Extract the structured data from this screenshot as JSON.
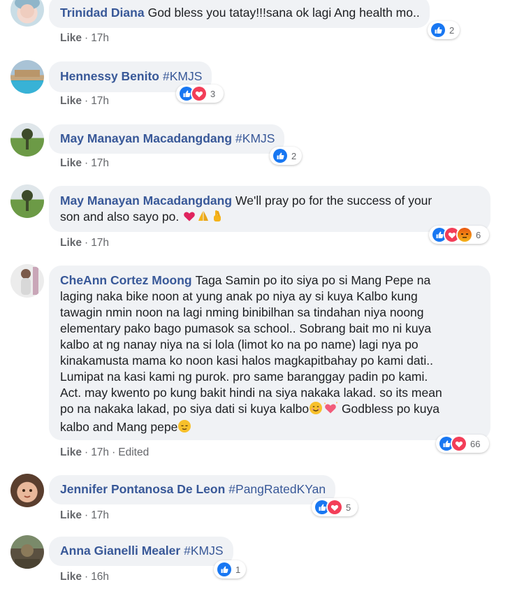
{
  "comments": [
    {
      "author": "Trinidad Diana",
      "text": "God bless you tatay!!!sana ok lagi Ang health mo..",
      "like_label": "Like",
      "time": "17h",
      "reactions": {
        "types": [
          "like"
        ],
        "count": "2"
      }
    },
    {
      "author": "Hennessy Benito",
      "tag": "#KMJS",
      "like_label": "Like",
      "time": "17h",
      "reactions": {
        "types": [
          "like",
          "love"
        ],
        "count": "3"
      }
    },
    {
      "author": "May Manayan Macadangdang",
      "tag": "#KMJS",
      "like_label": "Like",
      "time": "17h",
      "reactions": {
        "types": [
          "like"
        ],
        "count": "2"
      }
    },
    {
      "author": "May Manayan Macadangdang",
      "line1": "We'll pray po for the success of your",
      "line2": "son and also sayo po.",
      "emojis": [
        "red-heart-emoji",
        "praying-hands-emoji",
        "crossed-fingers-emoji"
      ],
      "like_label": "Like",
      "time": "17h",
      "reactions": {
        "types": [
          "like",
          "love",
          "angry"
        ],
        "count": "6"
      }
    },
    {
      "author": "CheAnn Cortez Moong",
      "lines": [
        "Taga Samin po ito siya po si Mang Pepe na",
        "laging naka bike noon at yung anak po niya ay si kuya Kalbo kung",
        "tawagin nmin noon na lagi nming binibilhan sa tindahan niya noong",
        "elementary pako bago pumasok sa school.. Sobrang bait mo ni kuya",
        "kalbo at ng nanay niya na si lola (limot ko na po name) lagi nya po",
        "kinakamusta mama ko noon kasi halos magkapitbahay po kami dati..",
        "Lumipat na kasi kami ng purok. pro same baranggay padin po kami.",
        "Act. may kwento po kung bakit hindi na siya nakaka lakad. so its mean",
        "po na nakaka lakad, po siya dati si kuya kalbo",
        "Godbless po kuya",
        "kalbo and Mang pepe"
      ],
      "emojis": [
        "smiling-face-emoji",
        "sparkling-heart-emoji",
        "relieved-face-emoji"
      ],
      "like_label": "Like",
      "time": "17h",
      "edited_label": "Edited",
      "reactions": {
        "types": [
          "like",
          "love"
        ],
        "count": "66"
      }
    },
    {
      "author": "Jennifer Pontanosa De Leon",
      "tag": "#PangRatedKYan",
      "like_label": "Like",
      "time": "17h",
      "reactions": {
        "types": [
          "like",
          "love"
        ],
        "count": "5"
      }
    },
    {
      "author": "Anna Gianelli Mealer",
      "tag": "#KMJS",
      "like_label": "Like",
      "time": "16h",
      "reactions": {
        "types": [
          "like"
        ],
        "count": "1"
      }
    }
  ],
  "colors": {
    "name": "#385898",
    "bubble": "#f0f2f5",
    "like_reaction": "#1877f2",
    "love_reaction": "#f33e58",
    "angry_reaction": "#e9710f"
  }
}
